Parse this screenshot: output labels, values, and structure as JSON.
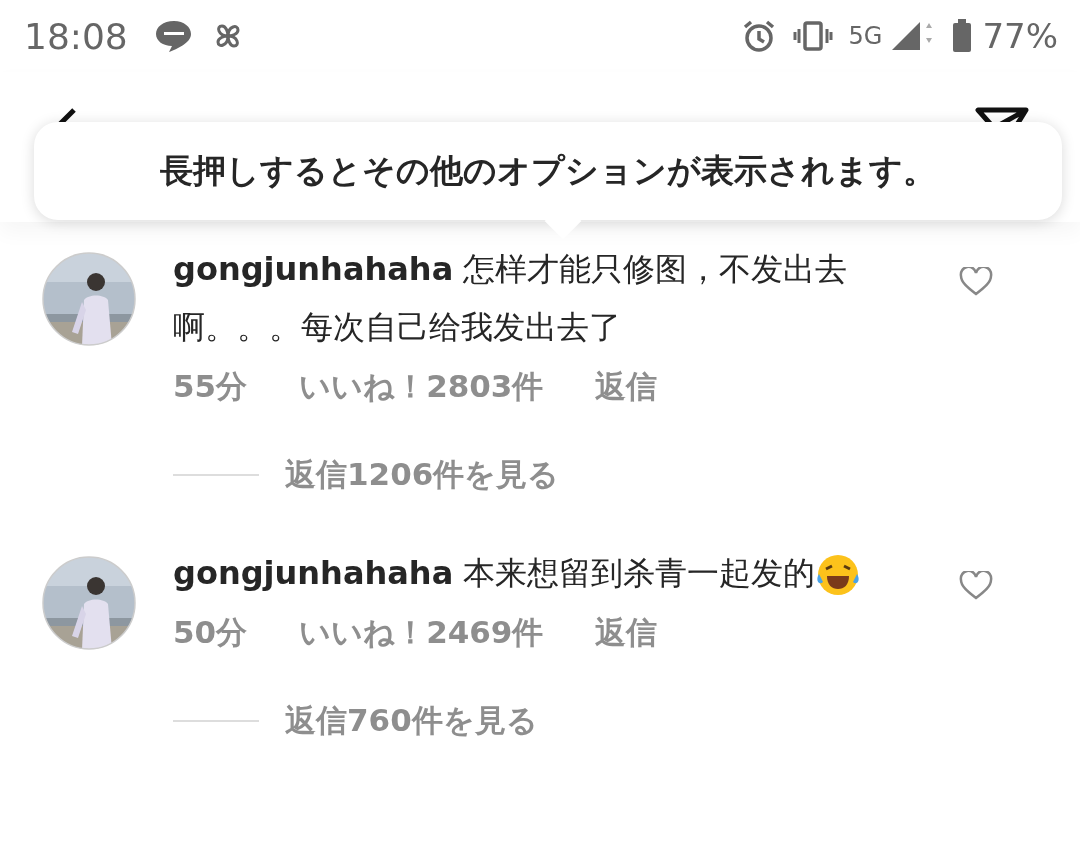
{
  "status_bar": {
    "time": "18:08",
    "network": "5G",
    "battery": "77%"
  },
  "tooltip": {
    "text": "長押しするとその他のオプションが表示されます。"
  },
  "comments": [
    {
      "text": "**gongjunhahaha** 怎样才能只修图，不发出去啊。。。每次自己给我发出去了",
      "emoji": false,
      "age": "55分",
      "likes": "いいね！2803件",
      "reply": "返信",
      "view_replies": "返信1206件を見る",
      "liked": false
    },
    {
      "text": "**gongjunhahaha** 本来想留到杀青一起发的",
      "emoji": true,
      "age": "50分",
      "likes": "いいね！2469件",
      "reply": "返信",
      "view_replies": "返信760件を見る",
      "liked": false
    }
  ]
}
